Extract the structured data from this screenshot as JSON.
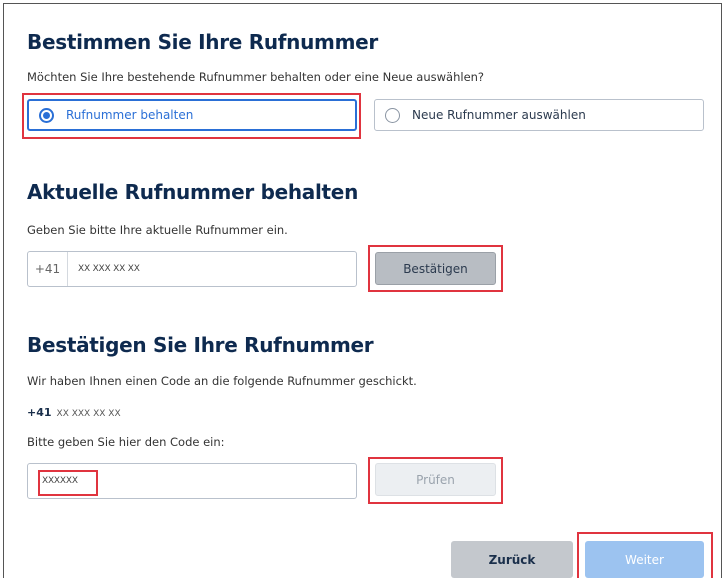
{
  "section1": {
    "title": "Bestimmen Sie Ihre Rufnummer",
    "question": "Möchten Sie Ihre bestehende Rufnummer behalten oder eine Neue auswählen?",
    "options": [
      {
        "label": "Rufnummer behalten",
        "selected": true
      },
      {
        "label": "Neue Rufnummer auswählen",
        "selected": false
      }
    ]
  },
  "section2": {
    "title": "Aktuelle Rufnummer behalten",
    "instruction": "Geben Sie bitte Ihre aktuelle Rufnummer ein.",
    "prefix": "+41",
    "phone_value": "XX XXX XX XX",
    "confirm_label": "Bestätigen"
  },
  "section3": {
    "title": "Bestätigen Sie Ihre Rufnummer",
    "info": "Wir haben Ihnen einen Code an die folgende Rufnummer geschickt.",
    "sent_prefix": "+41",
    "sent_number": "XX XXX XX XX",
    "code_prompt": "Bitte geben Sie hier den Code ein:",
    "code_value": "XXXXXX",
    "check_label": "Prüfen"
  },
  "footer": {
    "back_label": "Zurück",
    "next_label": "Weiter"
  },
  "colors": {
    "accent": "#2a6fd6",
    "highlight": "#e0343f",
    "heading": "#0e2a4f"
  }
}
